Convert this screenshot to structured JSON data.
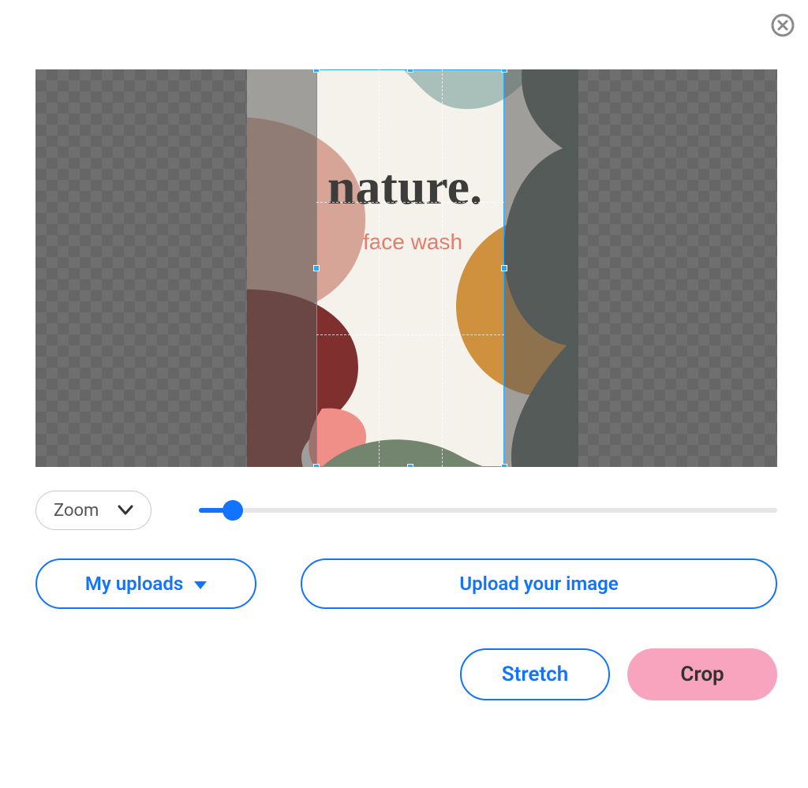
{
  "close_icon": "close",
  "artwork": {
    "brand": "nature.",
    "subtitle": "face wash",
    "colors": {
      "bg": "#f5f2eb",
      "tealBlob": "#a9c0ba",
      "peachBlob": "#d6a597",
      "redBlob": "#7f2f2d",
      "amberBlob": "#cf913e",
      "greenBlob": "#73856f",
      "slateBlob": "#4f5d58",
      "pink": "#ef8f87",
      "brandText": "#3c3c3b",
      "subtitleText": "#e07d6d"
    }
  },
  "zoom": {
    "label": "Zoom",
    "value": 5,
    "min": 0,
    "max": 100
  },
  "uploads": {
    "my_uploads_label": "My uploads",
    "upload_label": "Upload your image"
  },
  "actions": {
    "stretch_label": "Stretch",
    "crop_label": "Crop"
  },
  "colors": {
    "primary": "#1273ff",
    "accent_pink": "#f9a4bf"
  }
}
